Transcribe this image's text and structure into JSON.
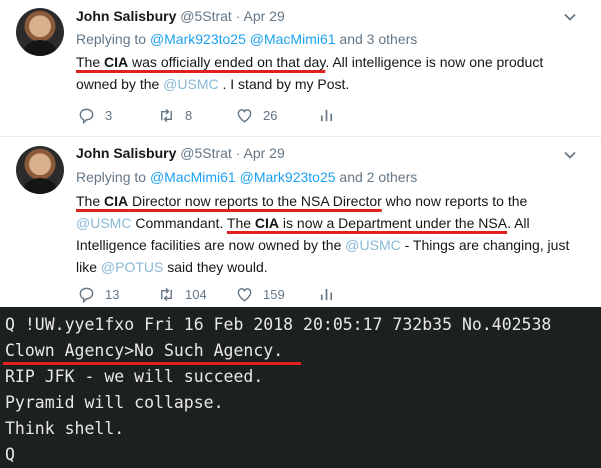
{
  "tweets": [
    {
      "name": "John Salisbury",
      "handle": "@5Strat",
      "sep": " · ",
      "date": "Apr 29",
      "replying_prefix": "Replying to ",
      "reply_handle_1": "@Mark923to25",
      "reply_handle_2": "@MacMimi61",
      "replying_suffix": " and 3 others",
      "text": {
        "p1": "The ",
        "p2": "CIA",
        "p3": " was officially ended on that day",
        "p4": ". All intelligence is now one product owned by the ",
        "p5": "@USMC",
        "p6": " .  I stand by my Post."
      },
      "replies": "3",
      "retweets": "8",
      "likes": "26"
    },
    {
      "name": "John Salisbury",
      "handle": "@5Strat",
      "sep": " · ",
      "date": "Apr 29",
      "replying_prefix": "Replying to ",
      "reply_handle_1": "@MacMimi61",
      "reply_handle_2": "@Mark923to25",
      "replying_suffix": " and 2 others",
      "text": {
        "p1": "The ",
        "p2": "CIA",
        "p3": " Director now reports to the NSA Director",
        "p4": " who now reports to the ",
        "p5": "@USMC",
        "p6": " Commandant. ",
        "p7": "The ",
        "p8": "CIA",
        "p9": " is now a Department under the NSA",
        "p10": ". All Intelligence facilities are now owned by the ",
        "p11": "@USMC",
        "p12": " - Things are changing, just like ",
        "p13": "@POTUS",
        "p14": " said they would."
      },
      "replies": "13",
      "retweets": "104",
      "likes": "159"
    }
  ],
  "chan_post": {
    "header": "Q !UW.yye1fxo  Fri 16 Feb 2018 20:05:17 732b35 No.402538",
    "lines": [
      "Clown Agency>No Such Agency.",
      "RIP JFK - we will succeed.",
      "Pyramid will collapse.",
      "Think shell.",
      "Q"
    ]
  },
  "colors": {
    "link": "#1da1f2",
    "underline_annotation": "#e0201c",
    "muted": "#657786",
    "terminal_bg": "#1d2021"
  }
}
